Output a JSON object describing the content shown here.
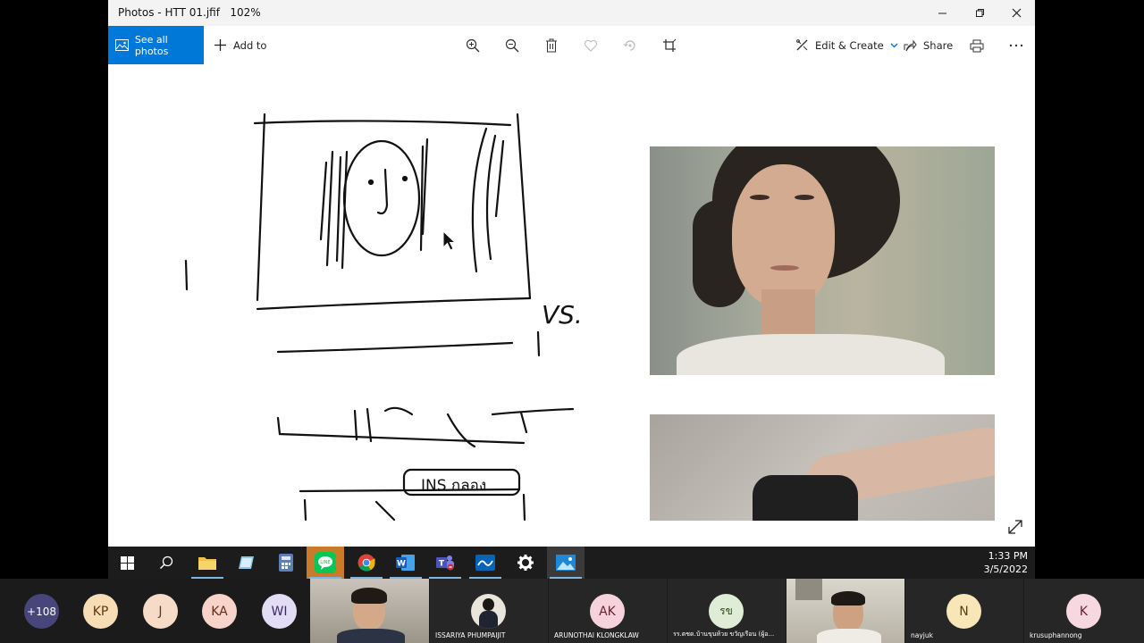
{
  "window": {
    "title": "Photos - HTT 01.jfif",
    "zoom": "102%"
  },
  "toolbar": {
    "see_all_photos": "See all photos",
    "add_to": "Add to",
    "edit_create": "Edit & Create",
    "share": "Share"
  },
  "sketch": {
    "vs_text": "VS.",
    "ins_text": "INS กลอง"
  },
  "clock": {
    "time": "1:33 PM",
    "date": "3/5/2022"
  },
  "participants": {
    "more_count": "+108",
    "avatars": [
      {
        "initials": "KP",
        "color": "#f6ddb6",
        "text": "#5a3a10"
      },
      {
        "initials": "J",
        "color": "#f6dcc8",
        "text": "#5a3a20"
      },
      {
        "initials": "KA",
        "color": "#f7d3c9",
        "text": "#6a2a1a"
      },
      {
        "initials": "WI",
        "color": "#e2dcf4",
        "text": "#3a2a6a"
      }
    ],
    "tiles": {
      "issariya": "ISSARIYA PHUMPAIJIT",
      "arunothai": "ARUNOTHAI KLONGKLAW",
      "arunothai_initials": "AK",
      "school": "รร.ตชด.บ้านขุนห้วย ขวัญเรือน (ผู้อ...",
      "school_initials": "รข",
      "nayjuk": "nayjuk",
      "nayjuk_initials": "N",
      "krusuphannong": "krusuphannong",
      "krusuphannong_initials": "K"
    }
  },
  "colors": {
    "accent": "#0078d7",
    "taskbar": "#1c1c1c"
  }
}
